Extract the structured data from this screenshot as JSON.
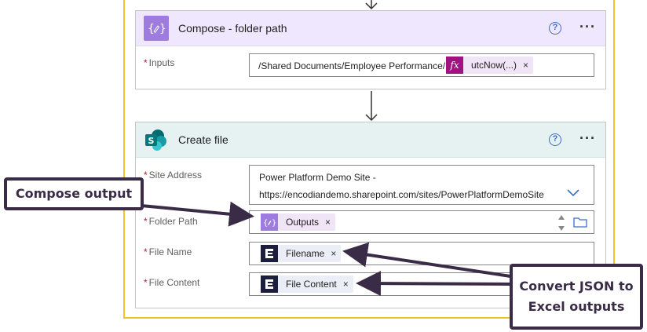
{
  "compose_card": {
    "title": "Compose - folder path",
    "inputs_label": "Inputs",
    "inputs_text": "/Shared Documents/Employee Performance/",
    "fx_symbol": "fx",
    "fx_token": "utcNow(...)",
    "help_glyph": "?",
    "more_glyph": "···",
    "icon": "curly-braces-edit-icon",
    "header_color": "#efe7fd",
    "icon_color": "#9e7bdf"
  },
  "create_file_card": {
    "title": "Create file",
    "help_glyph": "?",
    "more_glyph": "···",
    "icon": "sharepoint-icon",
    "header_color": "#e6f1f1",
    "icon_color": "#036c70",
    "site_address_label": "Site Address",
    "site_address_line1": "Power Platform Demo Site -",
    "site_address_line2": "https://encodiandemo.sharepoint.com/sites/PowerPlatformDemoSite",
    "folder_path_label": "Folder Path",
    "folder_token": "Outputs",
    "file_name_label": "File Name",
    "file_name_token": "Filename",
    "file_content_label": "File Content",
    "file_content_token": "File Content",
    "token_close": "×",
    "required_mark": "*"
  },
  "callouts": {
    "compose_output": "Compose output",
    "convert_line1": "Convert JSON to",
    "convert_line2": "Excel outputs"
  },
  "colors": {
    "frame": "#f2c12e",
    "callout": "#3a2b47"
  }
}
